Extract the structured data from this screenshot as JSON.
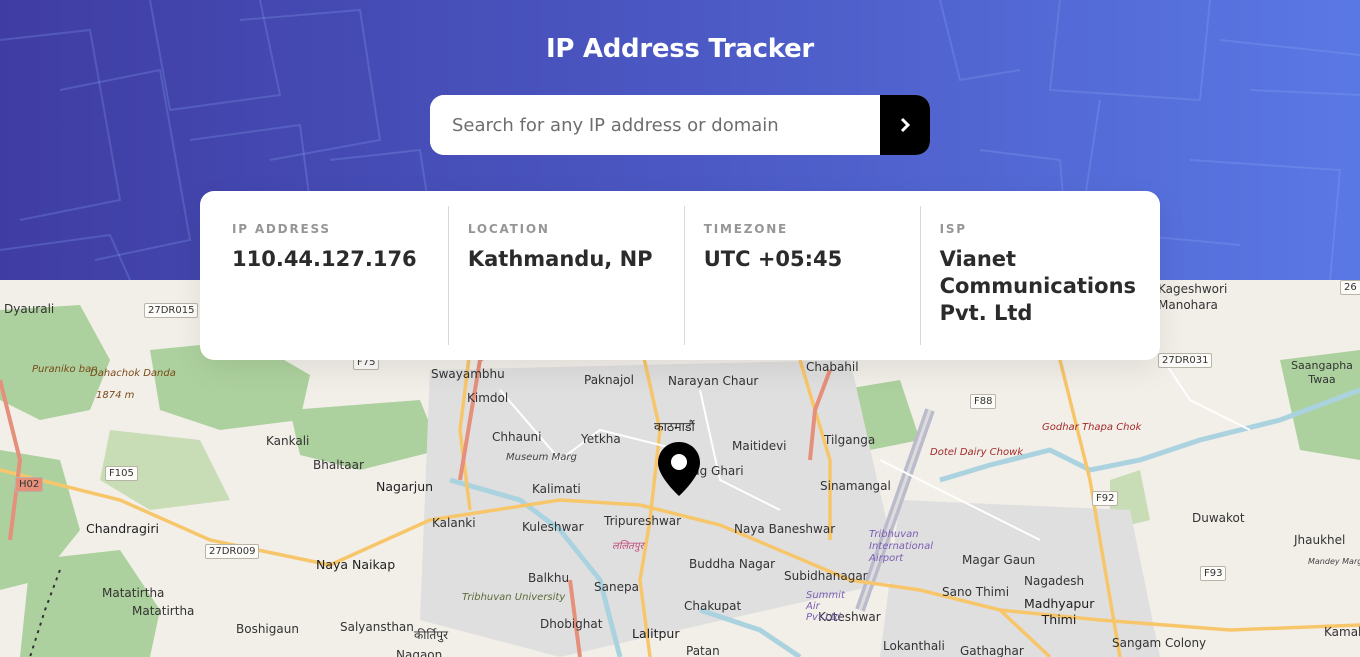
{
  "header": {
    "title": "IP Address Tracker"
  },
  "search": {
    "placeholder": "Search for any IP address or domain",
    "value": "",
    "button_icon": "chevron-right-icon"
  },
  "info": {
    "ip": {
      "label": "IP ADDRESS",
      "value": "110.44.127.176"
    },
    "location": {
      "label": "LOCATION",
      "value": "Kathmandu, NP"
    },
    "timezone": {
      "label": "TIMEZONE",
      "value": "UTC +05:45"
    },
    "isp": {
      "label": "ISP",
      "value": "Vianet Communications Pvt. Ltd"
    }
  },
  "map": {
    "places": [
      "Dyaurali",
      "Puraniko ban",
      "Dahachok Danda",
      "1874 m",
      "Kankali",
      "Bhaltaar",
      "Chandragiri",
      "Matatirtha",
      "Matatirtha",
      "Boshigaun",
      "Salyansthan",
      "Nagarjun",
      "Naya Naikap",
      "Kalanki",
      "Swayambhu",
      "Kimdol",
      "Chhauni",
      "Museum Marg",
      "Kalimati",
      "Kuleshwar",
      "Balkhu",
      "Tribhuvan University",
      "Dhobighat",
      "Paknajol",
      "Narayan Chaur",
      "Chabahil",
      "काठमाडौं",
      "Yetkha",
      "Maitidevi",
      "Tilganga",
      "Bag Ghari",
      "Tripureshwar",
      "Naya Baneshwar",
      "Sinamangal",
      "Buddha Nagar",
      "Sanepa",
      "Chakupat",
      "Lalitpur",
      "Patan",
      "Subidhanagar",
      "Koteshwar",
      "Lokanthali",
      "Gathaghar",
      "Tribhuvan International Airport",
      "Summit Air Pvt.Ltd",
      "Dotel Dairy Chowk",
      "Godhar Thapa Chok",
      "Magar Gaun",
      "Nagadesh",
      "Sano Thimi",
      "Madhyapur Thimi",
      "Sangam Colony",
      "Duwakot",
      "Jhaukhel",
      "Kamal",
      "Kageshwori Manohara",
      "Saangapha Twaa",
      "कीर्तिपुर",
      "Nagaon",
      "ललितपुर",
      "Mandey Marg"
    ],
    "road_badges": [
      "27DR015",
      "F75",
      "F105",
      "H02",
      "27DR009",
      "F88",
      "F92",
      "F93",
      "27DR031",
      "26"
    ]
  },
  "colors": {
    "accent_dark": "#3f3da3",
    "accent_light": "#5a78e4",
    "button": "#000000"
  }
}
